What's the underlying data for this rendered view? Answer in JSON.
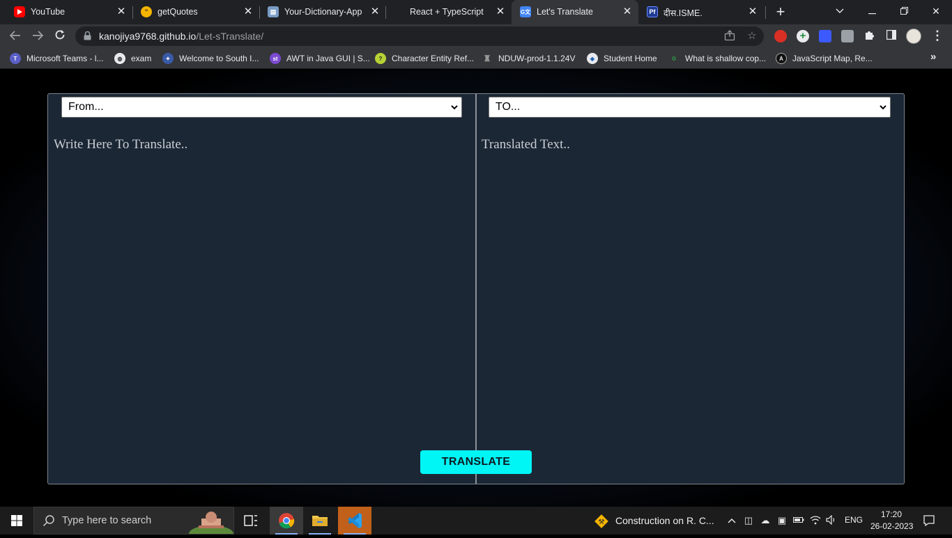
{
  "browser": {
    "tabs": [
      {
        "title": "YouTube",
        "icon": "youtube-icon",
        "color": "#ff0000"
      },
      {
        "title": "getQuotes",
        "icon": "quotes-icon",
        "color": "#f4b400"
      },
      {
        "title": "Your-Dictionary-App",
        "icon": "dictionary-icon",
        "color": "#7a9cc6"
      },
      {
        "title": "React + TypeScript + I",
        "icon": "react-icon",
        "color": "#35363a"
      },
      {
        "title": "Let's Translate",
        "icon": "translate-icon",
        "color": "#4285f4"
      },
      {
        "title": "दीस.ISME.",
        "icon": "pf-icon",
        "color": "#3b5bdb"
      }
    ],
    "active_tab": 4,
    "new_tab_label": "+",
    "url": {
      "host": "kanojiya9768.github.io",
      "path": "/Let-sTranslate/"
    },
    "bookmarks": [
      {
        "label": "Microsoft Teams - l...",
        "icon": "teams-icon",
        "color": "#5b5fc7"
      },
      {
        "label": "exam",
        "icon": "globe-icon",
        "color": "#e8eaed"
      },
      {
        "label": "Welcome to South I...",
        "icon": "university-icon",
        "color": "#3a5aa8"
      },
      {
        "label": "AWT in Java GUI | S...",
        "icon": "st-icon",
        "color": "#7b4bd1"
      },
      {
        "label": "Character Entity Ref...",
        "icon": "help-icon",
        "color": "#b5d334"
      },
      {
        "label": "NDUW-prod-1.1.24V",
        "icon": "emblem-icon",
        "color": "#9a9a9a"
      },
      {
        "label": "Student Home",
        "icon": "student-icon",
        "color": "#e8eaed"
      },
      {
        "label": "What is shallow cop...",
        "icon": "gfg-icon",
        "color": "#2f8d46"
      },
      {
        "label": "JavaScript Map, Re...",
        "icon": "js-icon",
        "color": "#222222"
      }
    ],
    "bookmarks_more": "»"
  },
  "app": {
    "from_select": "From...",
    "to_select": "TO...",
    "input_placeholder": "Write Here To Translate..",
    "output_placeholder": "Translated Text..",
    "translate_button": "TRANSLATE",
    "accent": "#00f5f5"
  },
  "taskbar": {
    "search_placeholder": "Type here to search",
    "weather_text": "Construction on R. C...",
    "language": "ENG",
    "time": "17:20",
    "date": "26-02-2023",
    "apps": [
      "chrome-icon",
      "file-explorer-icon",
      "vscode-icon"
    ]
  }
}
